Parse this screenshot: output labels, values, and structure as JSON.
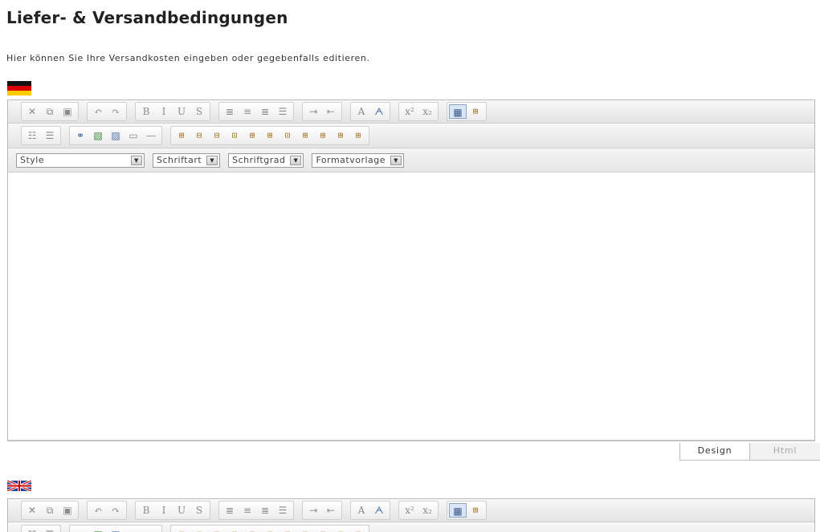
{
  "page": {
    "title": "Liefer- & Versandbedingungen",
    "intro": "Hier können Sie Ihre Versandkosten eingeben oder gegebenfalls editieren."
  },
  "editors": [
    {
      "language": "de",
      "flag_icon": "german-flag-icon",
      "toolbar_row1": [
        {
          "name": "cut-icon",
          "glyph": "✕"
        },
        {
          "name": "copy-icon",
          "glyph": "⧉"
        },
        {
          "name": "paste-icon",
          "glyph": "▣"
        },
        {
          "name": "undo-icon",
          "glyph": "↶"
        },
        {
          "name": "redo-icon",
          "glyph": "↷"
        },
        {
          "name": "bold-icon",
          "glyph": "B"
        },
        {
          "name": "italic-icon",
          "glyph": "I"
        },
        {
          "name": "underline-icon",
          "glyph": "U"
        },
        {
          "name": "strikethrough-icon",
          "glyph": "S"
        },
        {
          "name": "align-left-icon",
          "glyph": "≣"
        },
        {
          "name": "align-center-icon",
          "glyph": "≡"
        },
        {
          "name": "align-right-icon",
          "glyph": "≣"
        },
        {
          "name": "align-justify-icon",
          "glyph": "☰"
        },
        {
          "name": "indent-icon",
          "glyph": "⇥"
        },
        {
          "name": "outdent-icon",
          "glyph": "⇤"
        },
        {
          "name": "font-color-icon",
          "glyph": "A"
        },
        {
          "name": "highlight-color-icon",
          "glyph": "ᗅ"
        },
        {
          "name": "superscript-icon",
          "glyph": "x²"
        },
        {
          "name": "subscript-icon",
          "glyph": "x₂"
        },
        {
          "name": "design-mode-icon",
          "glyph": "▦"
        },
        {
          "name": "table-border-icon",
          "glyph": "⊞"
        }
      ],
      "toolbar_row2": [
        {
          "name": "numbered-list-icon",
          "glyph": "☷"
        },
        {
          "name": "bulleted-list-icon",
          "glyph": "☰"
        },
        {
          "name": "link-icon",
          "glyph": "⚭"
        },
        {
          "name": "image-icon",
          "glyph": "▧"
        },
        {
          "name": "image-manager-icon",
          "glyph": "▨"
        },
        {
          "name": "horizontal-rule-box-icon",
          "glyph": "▭"
        },
        {
          "name": "horizontal-rule-icon",
          "glyph": "―"
        },
        {
          "name": "insert-table-icon",
          "glyph": "⊞"
        },
        {
          "name": "insert-row-above-icon",
          "glyph": "⊟"
        },
        {
          "name": "insert-row-below-icon",
          "glyph": "⊟"
        },
        {
          "name": "delete-row-icon",
          "glyph": "⊡"
        },
        {
          "name": "insert-column-left-icon",
          "glyph": "⊞"
        },
        {
          "name": "insert-column-right-icon",
          "glyph": "⊞"
        },
        {
          "name": "delete-column-icon",
          "glyph": "⊡"
        },
        {
          "name": "merge-cells-icon",
          "glyph": "⊞"
        },
        {
          "name": "split-cell-icon",
          "glyph": "⊞"
        },
        {
          "name": "cell-properties-icon",
          "glyph": "⊞"
        },
        {
          "name": "table-properties-icon",
          "glyph": "⊞"
        }
      ],
      "dropdowns": {
        "style": "Style",
        "font": "Schriftart",
        "size": "Schriftgrad",
        "format": "Formatvorlage"
      },
      "content": "",
      "modes": {
        "design": "Design",
        "html": "Html"
      }
    },
    {
      "language": "en",
      "flag_icon": "uk-flag-icon"
    }
  ],
  "colors": {
    "flag_black": "#111111",
    "flag_red": "#dd0000",
    "flag_gold": "#ffcc00",
    "uk_blue": "#1f3a93",
    "uk_red": "#cc0000"
  }
}
